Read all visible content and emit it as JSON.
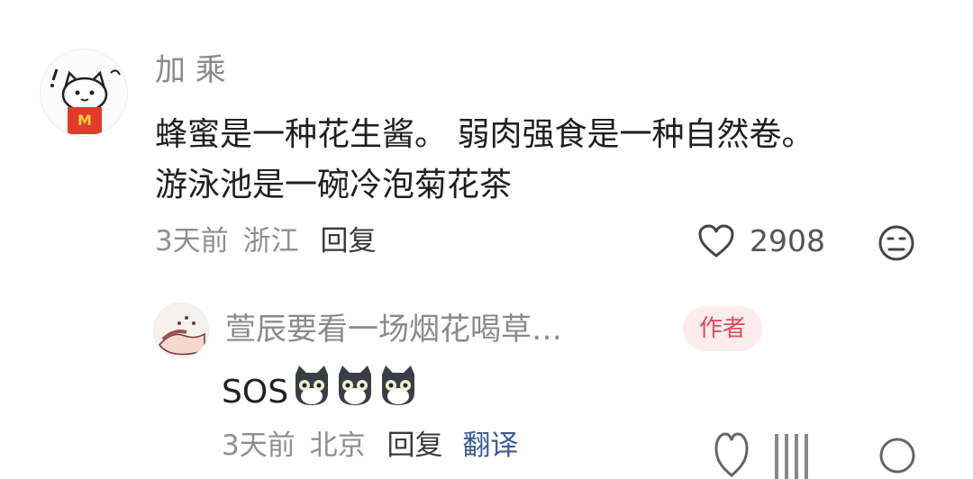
{
  "comment": {
    "username": "加 乘",
    "text_line1": "蜂蜜是一种花生酱。 弱肉强食是一种自然卷。",
    "text_line2": "游泳池是一碗冷泡菊花茶",
    "time": "3天前",
    "location": "浙江",
    "reply_label": "回复",
    "like_count": "2908",
    "icons": [
      "heart-icon",
      "meh-face-icon"
    ]
  },
  "sub_reply": {
    "username": "萱辰要看一场烟花喝草…",
    "badge": "作者",
    "text": "SOS",
    "emoji_count": 3,
    "time": "3天前",
    "location": "北京",
    "reply_label": "回复",
    "translate_label": "翻译",
    "icons": [
      "cat-emoji-icon",
      "heart-icon",
      "meh-face-icon"
    ]
  },
  "colors": {
    "username": "#8a8a8a",
    "meta": "#8f8f8f",
    "badge_bg": "#fdecee",
    "badge_text": "#e24a5a",
    "translate": "#3b5a9a"
  }
}
